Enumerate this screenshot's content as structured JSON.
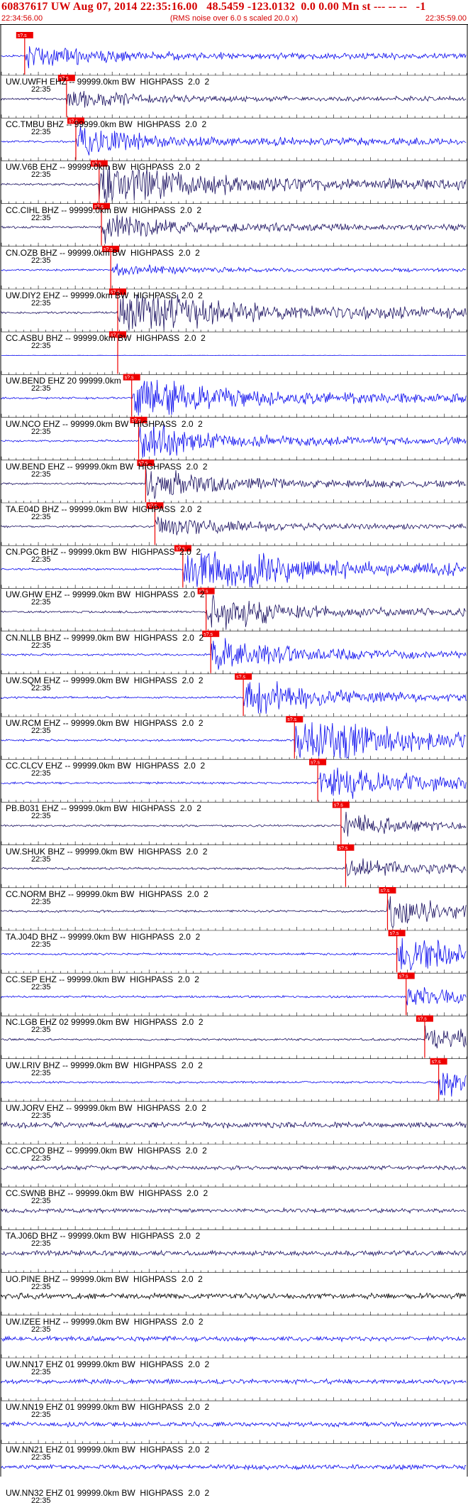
{
  "header": {
    "title": "60837617 UW Aug 07, 2014 22:35:16.00   48.5459 -123.0132  0.0 0.00 Mn st --- -- --   -1",
    "start_time": "22:34:56.00",
    "scale_note": "(RMS noise over 6.0 s scaled 20.0 x)",
    "end_time": "22:35:59.00"
  },
  "colors": {
    "header_red": "#d40000",
    "blue_trace": "#0a0aee",
    "dark_trace": "#1a1060",
    "pick_box": "#ee0000",
    "pick_line": "#ee0000"
  },
  "pick_marker_text": "s?.s",
  "time_label": "22:35",
  "traces": [
    {
      "label": "UW.UWFH EHZ -- 99999.0km BW  HIGHPASS  2.0  2",
      "color": "blue",
      "amp": 0.35,
      "pick": 0.05
    },
    {
      "label": "CC.TMBU BHZ -- 99999.0km BW  HIGHPASS  2.0  2",
      "color": "dark",
      "amp": 0.25,
      "pick": 0.14
    },
    {
      "label": "UW.V6B EHZ -- 99999.0km BW  HIGHPASS  2.0  2",
      "color": "blue",
      "amp": 0.45,
      "pick": 0.16
    },
    {
      "label": "CC.CIHL BHZ -- 99999.0km BW  HIGHPASS  2.0  2",
      "color": "dark",
      "amp": 0.9,
      "pick": 0.21
    },
    {
      "label": "CN.OZB BHZ -- 99999.0km BW  HIGHPASS  2.0  2",
      "color": "dark",
      "amp": 0.4,
      "pick": 0.215
    },
    {
      "label": "UW.DIY2 EHZ -- 99999.0km BW  HIGHPASS  2.0  2",
      "color": "blue",
      "amp": 0.15,
      "pick": 0.235
    },
    {
      "label": "CC.ASBU BHZ -- 99999.0km BW  HIGHPASS  2.0  2",
      "color": "dark",
      "amp": 0.9,
      "pick": 0.25
    },
    {
      "label": "UW.BEND EHZ 20 99999.0km",
      "color": "blue",
      "amp": 0.0,
      "pick": 0.25
    },
    {
      "label": "UW.NCO EHZ -- 99999.0km BW  HIGHPASS  2.0  2",
      "color": "blue",
      "amp": 0.7,
      "pick": 0.28
    },
    {
      "label": "UW.BEND EHZ -- 99999.0km BW  HIGHPASS  2.0  2",
      "color": "blue",
      "amp": 0.5,
      "pick": 0.295
    },
    {
      "label": "TA.E04D BHZ -- 99999.0km BW  HIGHPASS  2.0  2",
      "color": "dark",
      "amp": 0.45,
      "pick": 0.31
    },
    {
      "label": "CN.PGC BHZ -- 99999.0km BW  HIGHPASS  2.0  2",
      "color": "dark",
      "amp": 0.3,
      "pick": 0.33
    },
    {
      "label": "UW.GHW EHZ -- 99999.0km BW  HIGHPASS  2.0  2",
      "color": "blue",
      "amp": 1.0,
      "pick": 0.39
    },
    {
      "label": "CN.NLLB BHZ -- 99999.0km BW  HIGHPASS  2.0  2",
      "color": "dark",
      "amp": 0.5,
      "pick": 0.44
    },
    {
      "label": "UW.SQM EHZ -- 99999.0km BW  HIGHPASS  2.0  2",
      "color": "blue",
      "amp": 0.45,
      "pick": 0.45
    },
    {
      "label": "UW.RCM EHZ -- 99999.0km BW  HIGHPASS  2.0  2",
      "color": "blue",
      "amp": 0.5,
      "pick": 0.52
    },
    {
      "label": "CC.CLCV EHZ -- 99999.0km BW  HIGHPASS  2.0  2",
      "color": "blue",
      "amp": 0.9,
      "pick": 0.63
    },
    {
      "label": "PB.B031 EHZ -- 99999.0km BW  HIGHPASS  2.0  2",
      "color": "blue",
      "amp": 0.6,
      "pick": 0.68
    },
    {
      "label": "UW.SHUK BHZ -- 99999.0km BW  HIGHPASS  2.0  2",
      "color": "dark",
      "amp": 0.3,
      "pick": 0.73
    },
    {
      "label": "CC.NORM BHZ -- 99999.0km BW  HIGHPASS  2.0  2",
      "color": "dark",
      "amp": 0.3,
      "pick": 0.74
    },
    {
      "label": "TA.J04D BHZ -- 99999.0km BW  HIGHPASS  2.0  2",
      "color": "dark",
      "amp": 0.4,
      "pick": 0.83
    },
    {
      "label": "CC.SEP EHZ -- 99999.0km BW  HIGHPASS  2.0  2",
      "color": "blue",
      "amp": 0.6,
      "pick": 0.85
    },
    {
      "label": "NC.LGB EHZ 02 99999.0km BW  HIGHPASS  2.0  2",
      "color": "blue",
      "amp": 0.3,
      "pick": 0.87
    },
    {
      "label": "UW.LRIV BHZ -- 99999.0km BW  HIGHPASS  2.0  2",
      "color": "dark",
      "amp": 0.35,
      "pick": 0.91
    },
    {
      "label": "UW.JORV EHZ -- 99999.0km BW  HIGHPASS  2.0  2",
      "color": "blue",
      "amp": 0.4,
      "pick": 0.94
    },
    {
      "label": "CC.CPCO BHZ -- 99999.0km BW  HIGHPASS  2.0  2",
      "color": "dark",
      "amp": 0.35,
      "pick": null
    },
    {
      "label": "CC.SWNB BHZ -- 99999.0km BW  HIGHPASS  2.0  2",
      "color": "dark",
      "amp": 0.2,
      "pick": null
    },
    {
      "label": "TA.J06D BHZ -- 99999.0km BW  HIGHPASS  2.0  2",
      "color": "dark",
      "amp": 0.2,
      "pick": null
    },
    {
      "label": "UO.PINE BHZ -- 99999.0km BW  HIGHPASS  2.0  2",
      "color": "dark",
      "amp": 0.3,
      "pick": null
    },
    {
      "label": "UW.IZEE HHZ -- 99999.0km BW  HIGHPASS  2.0  2",
      "color": "black",
      "amp": 0.35,
      "pick": null
    },
    {
      "label": "UW.NN17 EHZ 01 99999.0km BW  HIGHPASS  2.0  2",
      "color": "blue",
      "amp": 0.25,
      "pick": null
    },
    {
      "label": "UW.NN19 EHZ 01 99999.0km BW  HIGHPASS  2.0  2",
      "color": "blue",
      "amp": 0.25,
      "pick": null
    },
    {
      "label": "UW.NN21 EHZ 01 99999.0km BW  HIGHPASS  2.0  2",
      "color": "blue",
      "amp": 0.25,
      "pick": null
    },
    {
      "label": "UW.NN32 EHZ 01 99999.0km BW  HIGHPASS  2.0  2",
      "color": "blue",
      "amp": 0.25,
      "pick": null
    }
  ]
}
